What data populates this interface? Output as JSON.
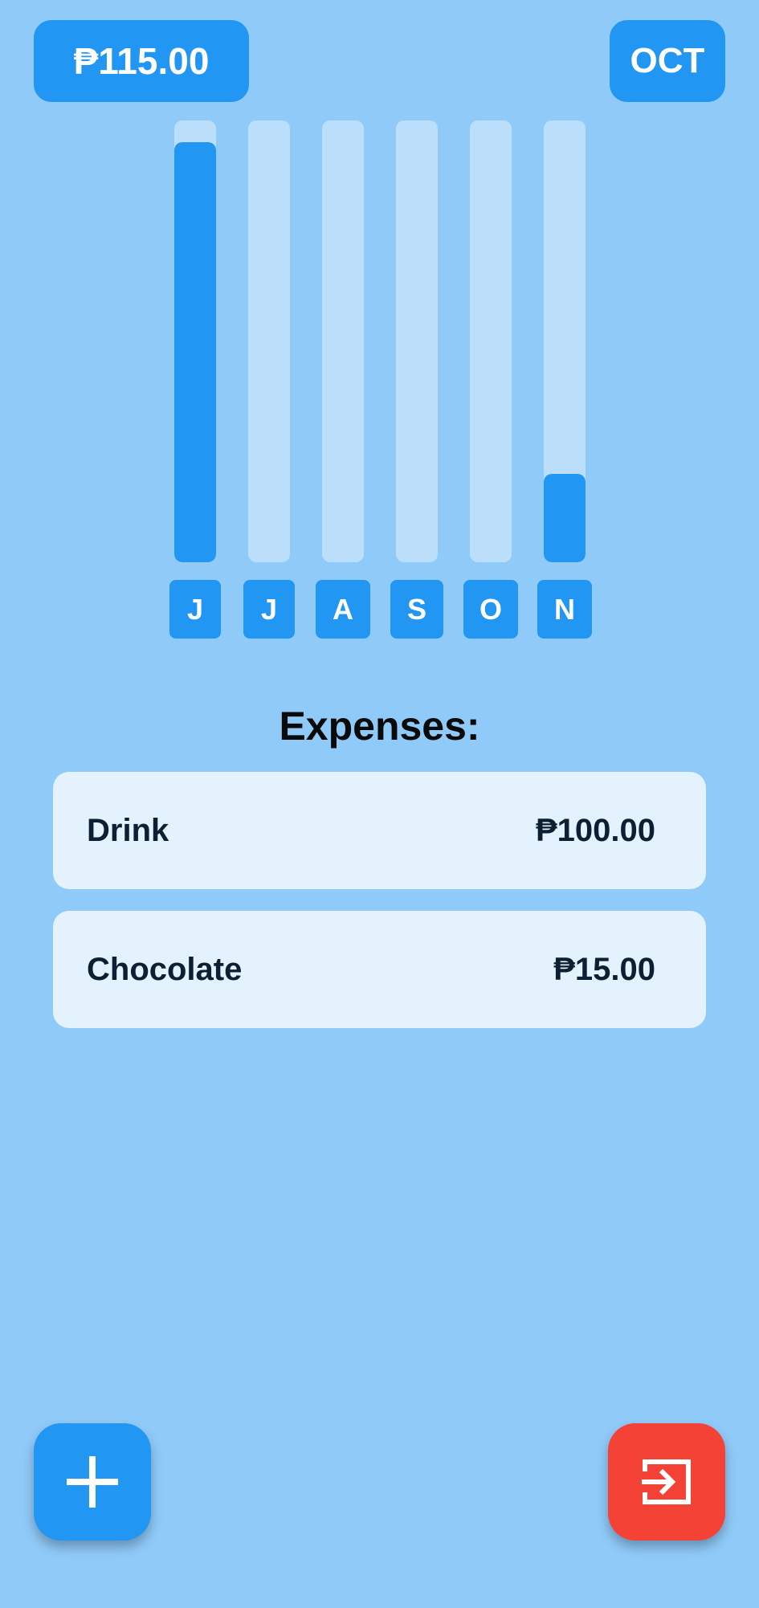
{
  "header": {
    "total_label": "₱115.00",
    "selected_month_label": "OCT"
  },
  "chart_data": {
    "type": "bar",
    "categories": [
      "J",
      "J",
      "A",
      "S",
      "O",
      "N"
    ],
    "values": [
      0.95,
      0,
      0,
      0,
      0,
      0.2
    ],
    "value_scale": "fraction of full bar",
    "colors": {
      "fill": "#2196F3",
      "track": "#BBDEFB"
    }
  },
  "expenses": {
    "title": "Expenses:",
    "items": [
      {
        "name": "Drink",
        "amount": "₱100.00"
      },
      {
        "name": "Chocolate",
        "amount": "₱15.00"
      }
    ]
  },
  "actions": {
    "add_icon": "plus-icon",
    "exit_icon": "logout-icon",
    "add_color": "#2196F3",
    "exit_color": "#F44336"
  }
}
